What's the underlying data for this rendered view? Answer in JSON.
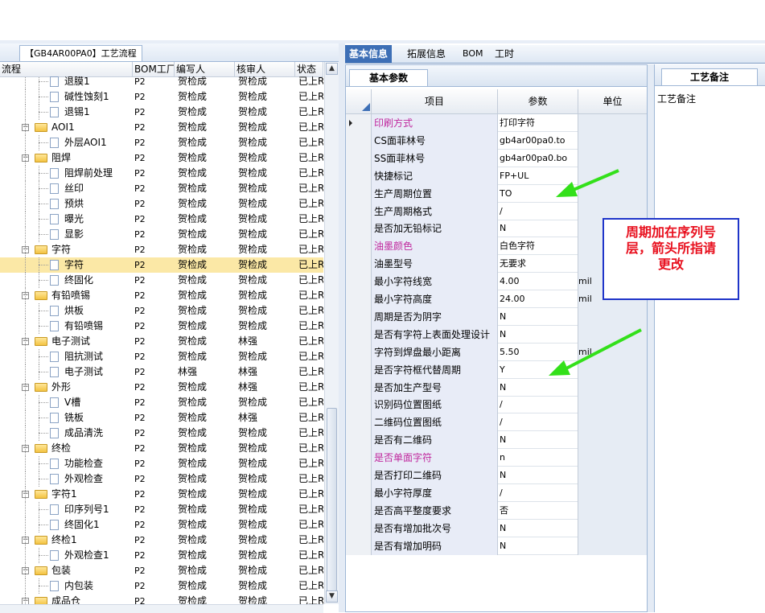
{
  "left": {
    "tab_title": "【GB4AR00PA0】工艺流程",
    "columns": [
      "流程",
      "BOM工厂",
      "编写人",
      "核审人",
      "状态"
    ],
    "rows": [
      {
        "name": "退膜1",
        "kind": "file",
        "plant": "P2",
        "writer": "贺检成",
        "reviewer": "贺检成",
        "status": "已上R"
      },
      {
        "name": "碱性蚀刻1",
        "kind": "file",
        "plant": "P2",
        "writer": "贺检成",
        "reviewer": "贺检成",
        "status": "已上R"
      },
      {
        "name": "退锡1",
        "kind": "file",
        "plant": "P2",
        "writer": "贺检成",
        "reviewer": "贺检成",
        "status": "已上R"
      },
      {
        "name": "AOI1",
        "kind": "folder",
        "plant": "P2",
        "writer": "贺检成",
        "reviewer": "贺检成",
        "status": "已上R"
      },
      {
        "name": "外层AOI1",
        "kind": "file",
        "plant": "P2",
        "writer": "贺检成",
        "reviewer": "贺检成",
        "status": "已上R"
      },
      {
        "name": "阻焊",
        "kind": "folder",
        "plant": "P2",
        "writer": "贺检成",
        "reviewer": "贺检成",
        "status": "已上R"
      },
      {
        "name": "阻焊前处理",
        "kind": "file",
        "plant": "P2",
        "writer": "贺检成",
        "reviewer": "贺检成",
        "status": "已上R"
      },
      {
        "name": "丝印",
        "kind": "file",
        "plant": "P2",
        "writer": "贺检成",
        "reviewer": "贺检成",
        "status": "已上R"
      },
      {
        "name": "预烘",
        "kind": "file",
        "plant": "P2",
        "writer": "贺检成",
        "reviewer": "贺检成",
        "status": "已上R"
      },
      {
        "name": "曝光",
        "kind": "file",
        "plant": "P2",
        "writer": "贺检成",
        "reviewer": "贺检成",
        "status": "已上R"
      },
      {
        "name": "显影",
        "kind": "file",
        "plant": "P2",
        "writer": "贺检成",
        "reviewer": "贺检成",
        "status": "已上R"
      },
      {
        "name": "字符",
        "kind": "folder",
        "plant": "P2",
        "writer": "贺检成",
        "reviewer": "贺检成",
        "status": "已上R"
      },
      {
        "name": "字符",
        "kind": "file",
        "plant": "P2",
        "writer": "贺检成",
        "reviewer": "贺检成",
        "status": "已上R",
        "selected": true
      },
      {
        "name": "终固化",
        "kind": "file",
        "plant": "P2",
        "writer": "贺检成",
        "reviewer": "贺检成",
        "status": "已上R"
      },
      {
        "name": "有铅喷锡",
        "kind": "folder",
        "plant": "P2",
        "writer": "贺检成",
        "reviewer": "贺检成",
        "status": "已上R"
      },
      {
        "name": "烘板",
        "kind": "file",
        "plant": "P2",
        "writer": "贺检成",
        "reviewer": "贺检成",
        "status": "已上R"
      },
      {
        "name": "有铅喷锡",
        "kind": "file",
        "plant": "P2",
        "writer": "贺检成",
        "reviewer": "贺检成",
        "status": "已上R"
      },
      {
        "name": "电子测试",
        "kind": "folder",
        "plant": "P2",
        "writer": "贺检成",
        "reviewer": "林强",
        "status": "已上R"
      },
      {
        "name": "阻抗测试",
        "kind": "file",
        "plant": "P2",
        "writer": "贺检成",
        "reviewer": "贺检成",
        "status": "已上R"
      },
      {
        "name": "电子测试",
        "kind": "file",
        "plant": "P2",
        "writer": "林强",
        "reviewer": "林强",
        "status": "已上R"
      },
      {
        "name": "外形",
        "kind": "folder",
        "plant": "P2",
        "writer": "贺检成",
        "reviewer": "林强",
        "status": "已上R"
      },
      {
        "name": "V槽",
        "kind": "file",
        "plant": "P2",
        "writer": "贺检成",
        "reviewer": "贺检成",
        "status": "已上R"
      },
      {
        "name": "铣板",
        "kind": "file",
        "plant": "P2",
        "writer": "贺检成",
        "reviewer": "林强",
        "status": "已上R"
      },
      {
        "name": "成品清洗",
        "kind": "file",
        "plant": "P2",
        "writer": "贺检成",
        "reviewer": "贺检成",
        "status": "已上R"
      },
      {
        "name": "终检",
        "kind": "folder",
        "plant": "P2",
        "writer": "贺检成",
        "reviewer": "贺检成",
        "status": "已上R"
      },
      {
        "name": "功能检查",
        "kind": "file",
        "plant": "P2",
        "writer": "贺检成",
        "reviewer": "贺检成",
        "status": "已上R"
      },
      {
        "name": "外观检查",
        "kind": "file",
        "plant": "P2",
        "writer": "贺检成",
        "reviewer": "贺检成",
        "status": "已上R"
      },
      {
        "name": "字符1",
        "kind": "folder",
        "plant": "P2",
        "writer": "贺检成",
        "reviewer": "贺检成",
        "status": "已上R"
      },
      {
        "name": "印序列号1",
        "kind": "file",
        "plant": "P2",
        "writer": "贺检成",
        "reviewer": "贺检成",
        "status": "已上R"
      },
      {
        "name": "终固化1",
        "kind": "file",
        "plant": "P2",
        "writer": "贺检成",
        "reviewer": "贺检成",
        "status": "已上R"
      },
      {
        "name": "终检1",
        "kind": "folder",
        "plant": "P2",
        "writer": "贺检成",
        "reviewer": "贺检成",
        "status": "已上R"
      },
      {
        "name": "外观检查1",
        "kind": "file",
        "plant": "P2",
        "writer": "贺检成",
        "reviewer": "贺检成",
        "status": "已上R"
      },
      {
        "name": "包装",
        "kind": "folder",
        "plant": "P2",
        "writer": "贺检成",
        "reviewer": "贺检成",
        "status": "已上R"
      },
      {
        "name": "内包装",
        "kind": "file",
        "plant": "P2",
        "writer": "贺检成",
        "reviewer": "贺检成",
        "status": "已上R"
      },
      {
        "name": "成品仓",
        "kind": "folder",
        "plant": "P2",
        "writer": "贺检成",
        "reviewer": "贺检成",
        "status": "已上R"
      }
    ]
  },
  "right": {
    "tabs": [
      "基本信息",
      "拓展信息",
      "BOM",
      "工时"
    ],
    "basic_tab": "基本参数",
    "grid_headers": {
      "item": "项目",
      "param": "参数",
      "unit": "单位"
    },
    "rows": [
      {
        "item": "印刷方式",
        "param": "打印字符",
        "unit": "",
        "magenta": true,
        "current": true
      },
      {
        "item": "CS面菲林号",
        "param": "gb4ar00pa0.to",
        "unit": ""
      },
      {
        "item": "SS面菲林号",
        "param": "gb4ar00pa0.bo",
        "unit": ""
      },
      {
        "item": "快捷标记",
        "param": "FP+UL",
        "unit": ""
      },
      {
        "item": "生产周期位置",
        "param": "TO",
        "unit": ""
      },
      {
        "item": "生产周期格式",
        "param": "/",
        "unit": ""
      },
      {
        "item": "是否加无铅标记",
        "param": "N",
        "unit": ""
      },
      {
        "item": "油墨颜色",
        "param": "白色字符",
        "unit": "",
        "magenta": true
      },
      {
        "item": "油墨型号",
        "param": "无要求",
        "unit": ""
      },
      {
        "item": "最小字符线宽",
        "param": "4.00",
        "unit": "mil"
      },
      {
        "item": "最小字符高度",
        "param": "24.00",
        "unit": "mil"
      },
      {
        "item": "周期是否为阴字",
        "param": "N",
        "unit": ""
      },
      {
        "item": "是否有字符上表面处理设计",
        "param": "N",
        "unit": ""
      },
      {
        "item": "字符到焊盘最小距离",
        "param": "5.50",
        "unit": "mil"
      },
      {
        "item": "是否字符框代替周期",
        "param": "Y",
        "unit": ""
      },
      {
        "item": "是否加生产型号",
        "param": "N",
        "unit": ""
      },
      {
        "item": "识别码位置图纸",
        "param": "/",
        "unit": ""
      },
      {
        "item": "二维码位置图纸",
        "param": "/",
        "unit": ""
      },
      {
        "item": "是否有二维码",
        "param": "N",
        "unit": ""
      },
      {
        "item": "是否单面字符",
        "param": "n",
        "unit": "",
        "magenta": true
      },
      {
        "item": "是否打印二维码",
        "param": "N",
        "unit": ""
      },
      {
        "item": "最小字符厚度",
        "param": "/",
        "unit": ""
      },
      {
        "item": "是否高平整度要求",
        "param": "否",
        "unit": ""
      },
      {
        "item": "是否有增加批次号",
        "param": "N",
        "unit": ""
      },
      {
        "item": "是否有增加明码",
        "param": "N",
        "unit": ""
      }
    ]
  },
  "remark": {
    "tab": "工艺备注",
    "label": "工艺备注"
  },
  "annotation": {
    "lines": [
      "周期加在序列号",
      "层，箭头所指请",
      "更改"
    ],
    "text_color": "#e8101e",
    "border_color": "#1f35c9",
    "arrow_color": "#33e01a"
  },
  "colors": {
    "accent": "#3d6fb6",
    "selection": "#fbe8a6",
    "magenta": "#c0289e"
  }
}
